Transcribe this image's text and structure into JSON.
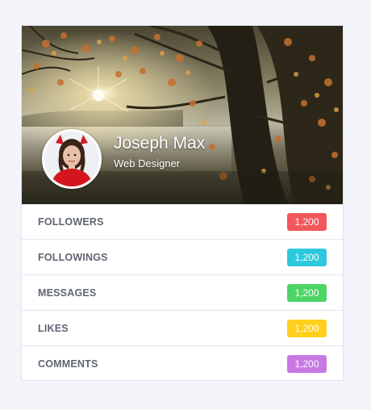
{
  "profile": {
    "name": "Joseph Max",
    "role": "Web Designer"
  },
  "stats": [
    {
      "label": "FOLLOWERS",
      "value": "1,200",
      "color": "#f2585b"
    },
    {
      "label": "FOLLOWINGS",
      "value": "1,200",
      "color": "#2ec8dc"
    },
    {
      "label": "MESSAGES",
      "value": "1,200",
      "color": "#4cd465"
    },
    {
      "label": "LIKES",
      "value": "1,200",
      "color": "#ffcf1c"
    },
    {
      "label": "COMMENTS",
      "value": "1,200",
      "color": "#c778e2"
    }
  ]
}
